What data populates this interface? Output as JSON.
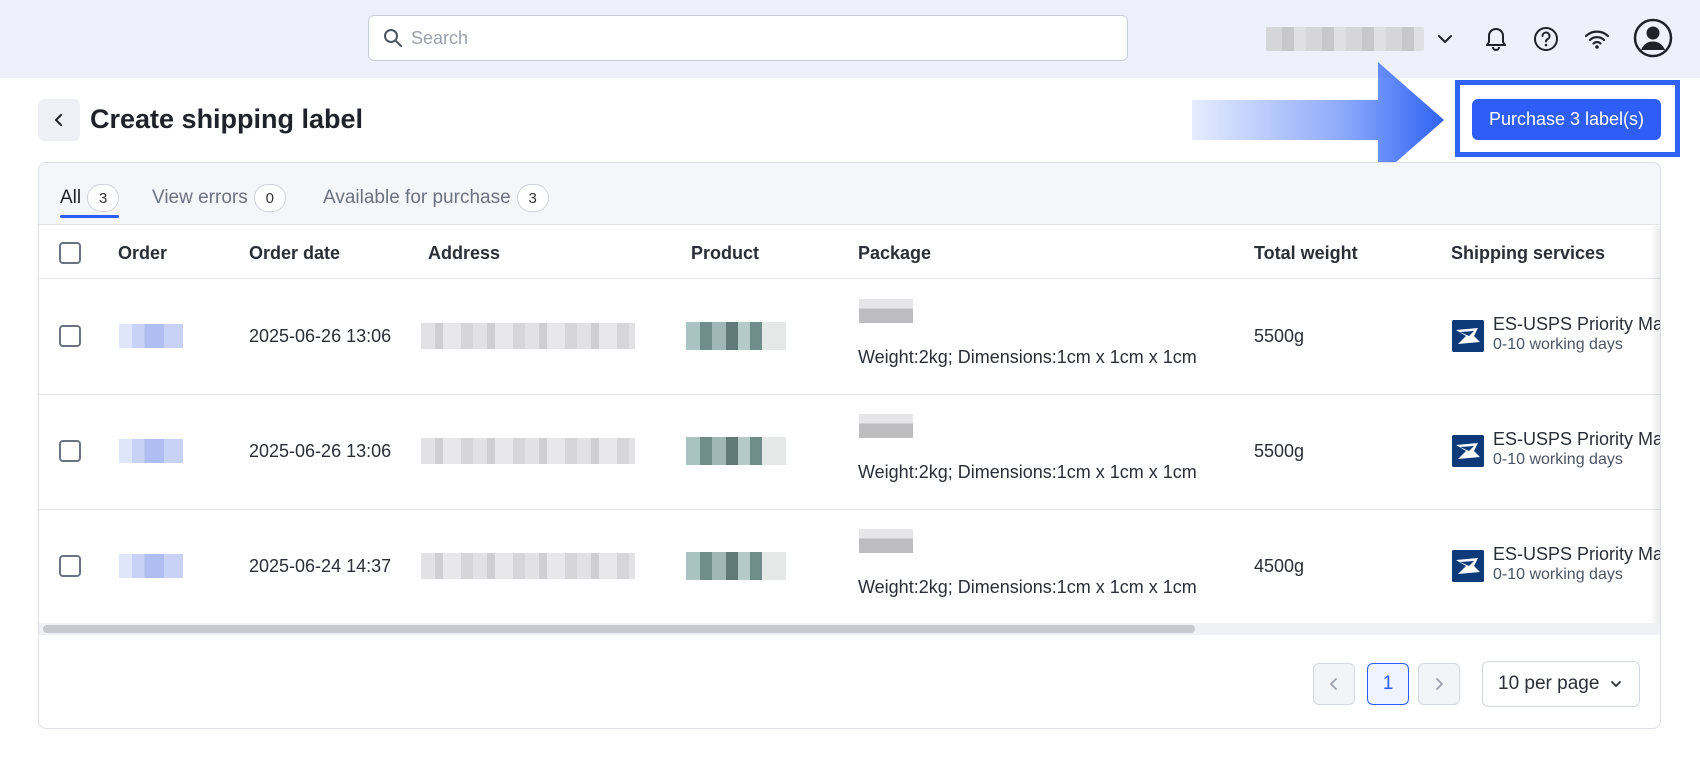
{
  "topbar": {
    "search_placeholder": "Search",
    "icons": [
      "search-icon",
      "chevron-down-icon",
      "bell-icon",
      "help-icon",
      "wifi-icon",
      "user-avatar-icon"
    ]
  },
  "header": {
    "title": "Create shipping label",
    "purchase_button": "Purchase 3 label(s)"
  },
  "tabs": [
    {
      "label": "All",
      "count": "3"
    },
    {
      "label": "View errors",
      "count": "0"
    },
    {
      "label": "Available for purchase",
      "count": "3"
    }
  ],
  "table": {
    "columns": [
      "Order",
      "Order date",
      "Address",
      "Product",
      "Package",
      "Total weight",
      "Shipping services"
    ],
    "rows": [
      {
        "order_date": "2025-06-26 13:06",
        "package": "Weight:2kg; Dimensions:1cm x 1cm x 1cm",
        "total_weight": "5500g",
        "service": "ES-USPS Priority Ma",
        "days": "0-10 working days"
      },
      {
        "order_date": "2025-06-26 13:06",
        "package": "Weight:2kg; Dimensions:1cm x 1cm x 1cm",
        "total_weight": "5500g",
        "service": "ES-USPS Priority Ma",
        "days": "0-10 working days"
      },
      {
        "order_date": "2025-06-24 14:37",
        "package": "Weight:2kg; Dimensions:1cm x 1cm x 1cm",
        "total_weight": "4500g",
        "service": "ES-USPS Priority Ma",
        "days": "0-10 working days"
      }
    ]
  },
  "pagination": {
    "current_page": "1",
    "per_page": "10 per page"
  },
  "colors": {
    "accent": "#2e5ef6",
    "topbar_bg": "#eef0fb",
    "usps_blue": "#0e3a7a"
  }
}
